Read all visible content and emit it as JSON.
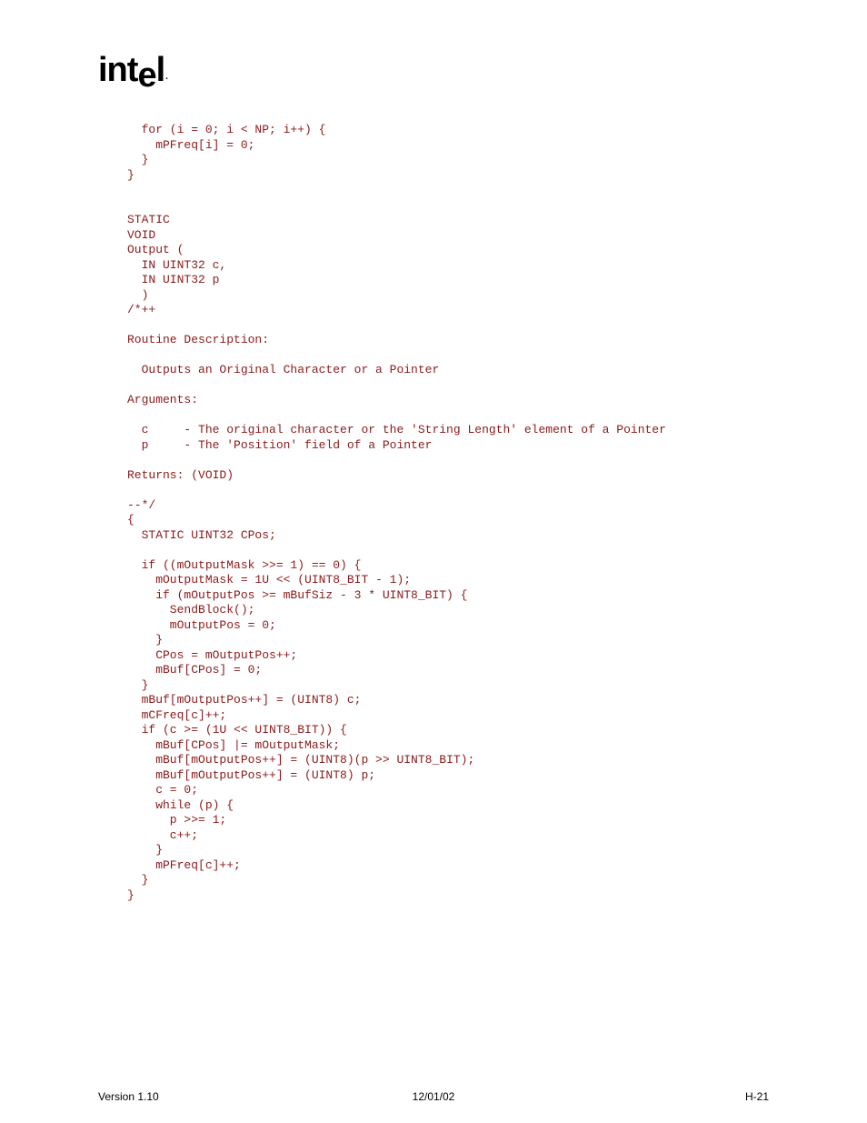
{
  "logo": {
    "text_a": "int",
    "text_b": "e",
    "text_c": "l"
  },
  "code": "  for (i = 0; i < NP; i++) {\n    mPFreq[i] = 0;\n  }\n}\n\n\nSTATIC\nVOID\nOutput (\n  IN UINT32 c,\n  IN UINT32 p\n  )\n/*++\n\nRoutine Description:\n\n  Outputs an Original Character or a Pointer\n\nArguments:\n\n  c     - The original character or the 'String Length' element of a Pointer\n  p     - The 'Position' field of a Pointer\n\nReturns: (VOID)\n\n--*/\n{\n  STATIC UINT32 CPos;\n\n  if ((mOutputMask >>= 1) == 0) {\n    mOutputMask = 1U << (UINT8_BIT - 1);\n    if (mOutputPos >= mBufSiz - 3 * UINT8_BIT) {\n      SendBlock();\n      mOutputPos = 0;\n    }\n    CPos = mOutputPos++;\n    mBuf[CPos] = 0;\n  }\n  mBuf[mOutputPos++] = (UINT8) c;\n  mCFreq[c]++;\n  if (c >= (1U << UINT8_BIT)) {\n    mBuf[CPos] |= mOutputMask;\n    mBuf[mOutputPos++] = (UINT8)(p >> UINT8_BIT);\n    mBuf[mOutputPos++] = (UINT8) p;\n    c = 0;\n    while (p) {\n      p >>= 1;\n      c++;\n    }\n    mPFreq[c]++;\n  }\n}",
  "footer": {
    "left": "Version 1.10",
    "center": "12/01/02",
    "right": "H-21"
  }
}
